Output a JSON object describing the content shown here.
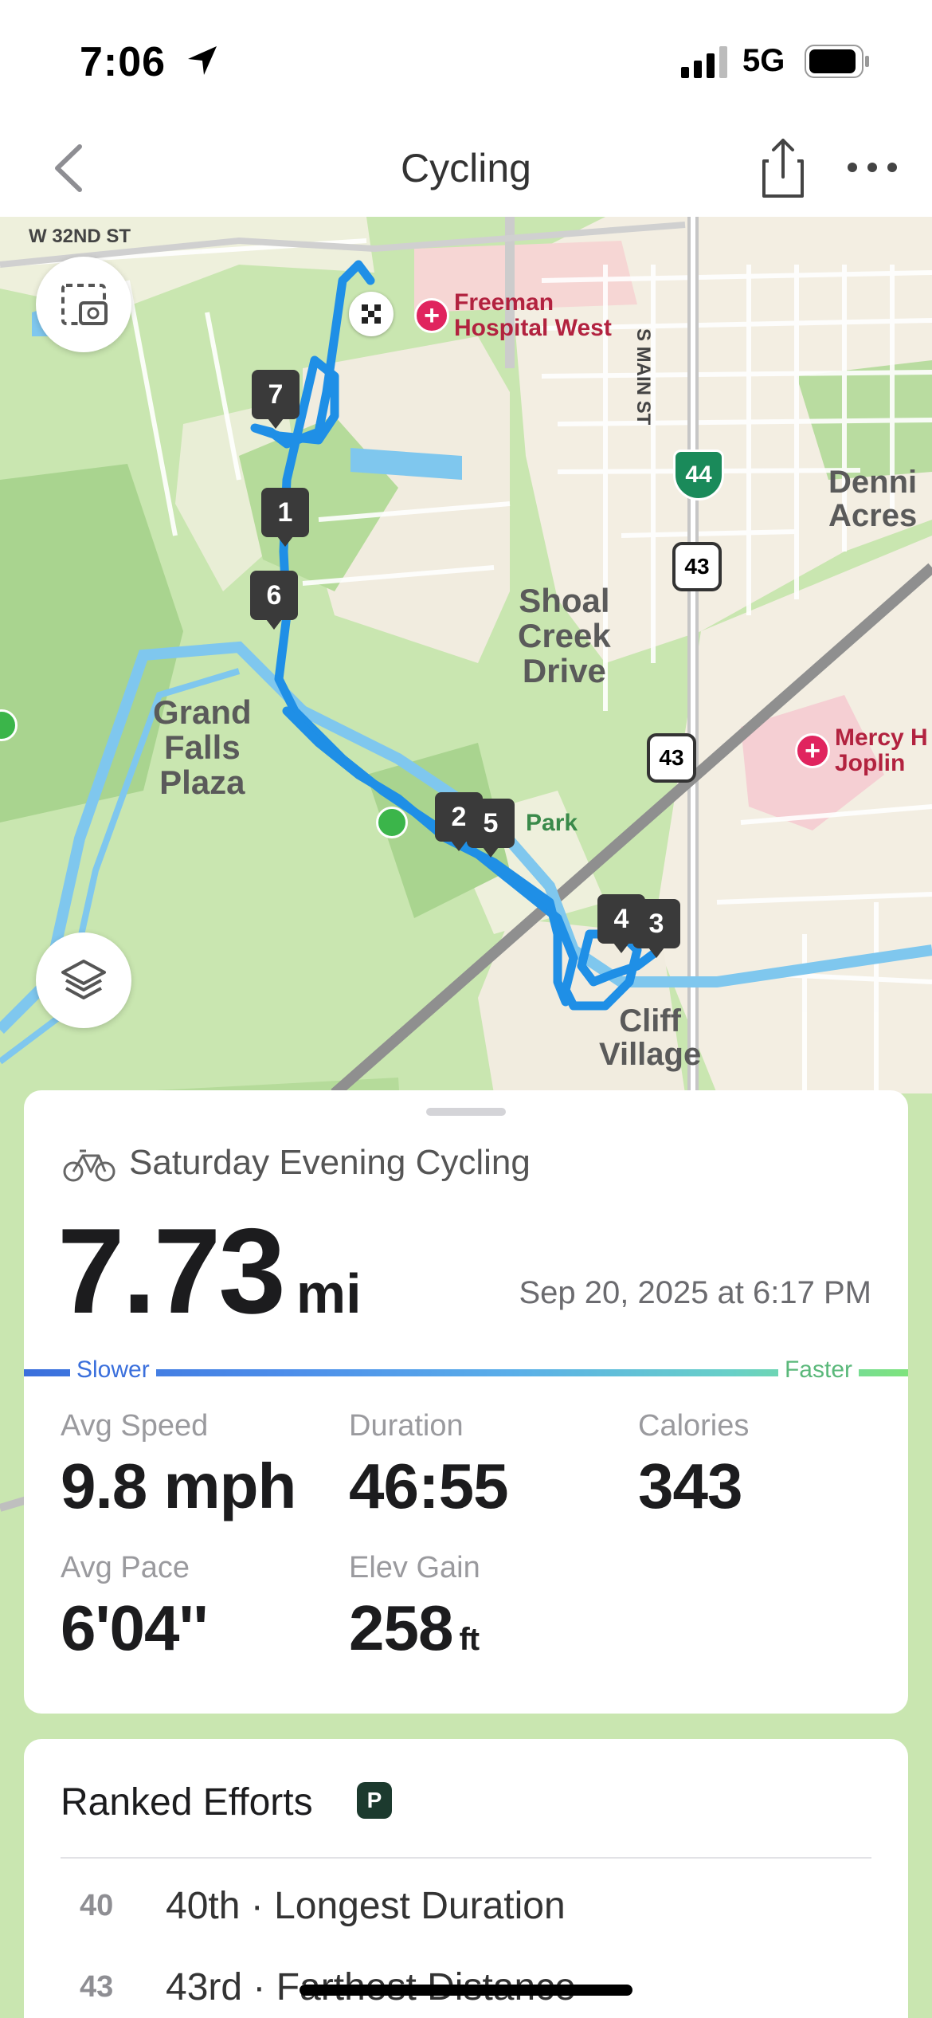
{
  "status_bar": {
    "time": "7:06",
    "network": "5G"
  },
  "nav": {
    "title": "Cycling"
  },
  "map": {
    "street_labels": {
      "w32nd": "W 32ND ST",
      "smain": "S MAIN ST",
      "freeman": "Freeman\nHospital West",
      "dennis": "Denni\nAcres",
      "shoal": "Shoal\nCreek\nDrive",
      "grand": "Grand\nFalls\nPlaza",
      "mercy": "Mercy H\nJoplin",
      "park": "Park",
      "cliff": "Cliff\nVillage"
    },
    "shields": {
      "i44": "44",
      "us43a": "43",
      "us43b": "43"
    },
    "markers": [
      "1",
      "2",
      "3",
      "4",
      "5",
      "6",
      "7"
    ]
  },
  "activity": {
    "title": "Saturday Evening Cycling",
    "distance": "7.73",
    "distance_unit": "mi",
    "date": "Sep 20, 2025 at 6:17 PM",
    "speed_slower": "Slower",
    "speed_faster": "Faster",
    "stats": {
      "avg_speed_label": "Avg Speed",
      "avg_speed": "9.8 mph",
      "duration_label": "Duration",
      "duration": "46:55",
      "calories_label": "Calories",
      "calories": "343",
      "avg_pace_label": "Avg Pace",
      "avg_pace": "6'04''",
      "elev_gain_label": "Elev Gain",
      "elev_gain": "258",
      "elev_gain_unit": "ft"
    }
  },
  "ranked_efforts": {
    "title": "Ranked Efforts",
    "badge": "P",
    "items": [
      {
        "rank": "40",
        "text": "40th · Longest Duration"
      },
      {
        "rank": "43",
        "text": "43rd · Farthest Distance"
      }
    ]
  },
  "colors": {
    "route": "#1f8fe6",
    "map_green": "#c9e6b0",
    "accent_red": "#e0245e"
  }
}
